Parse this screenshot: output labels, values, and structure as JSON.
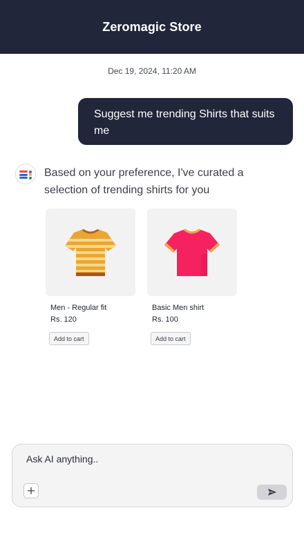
{
  "header": {
    "title": "Zeromagic Store"
  },
  "chat": {
    "timestamp": "Dec 19, 2024, 11:20 AM",
    "user_message": "Suggest me trending Shirts that suits me",
    "bot_message": "Based on your preference, I've curated a selection of trending shirts for you"
  },
  "products": [
    {
      "name": "Men - Regular fit",
      "price": "Rs. 120",
      "button_label": "Add to cart",
      "image_icon": "striped-tshirt-icon",
      "color": "#e9a63a"
    },
    {
      "name": "Basic Men shirt",
      "price": "Rs. 100",
      "button_label": "Add to cart",
      "image_icon": "pink-tshirt-icon",
      "color": "#f4225f"
    }
  ],
  "composer": {
    "placeholder": "Ask AI anything..",
    "attach_icon": "plus-icon",
    "send_icon": "send-icon"
  },
  "colors": {
    "header_bg": "#21263a",
    "user_bubble_bg": "#21263a",
    "card_bg": "#f2f2f3"
  }
}
